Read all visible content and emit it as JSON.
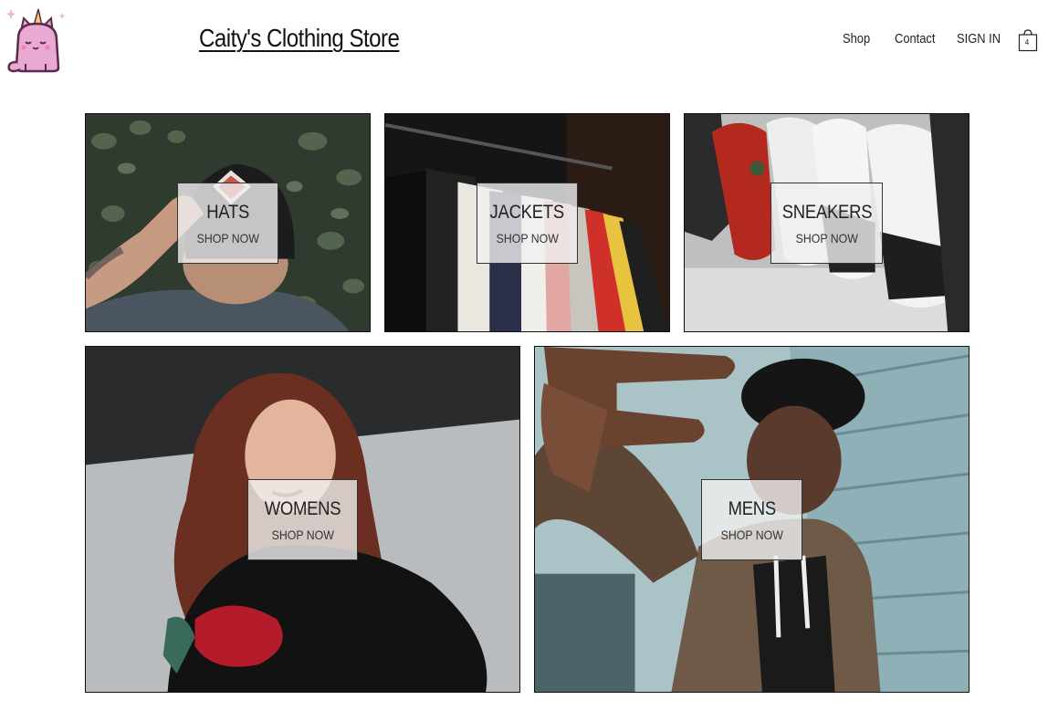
{
  "header": {
    "store_title": "Caity's Clothing Store",
    "logo_icon": "unicorn-cat-icon",
    "cart_icon": "shopping-bag-icon",
    "cart_count": "4"
  },
  "nav": {
    "shop": "Shop",
    "contact": "Contact",
    "sign_in": "SIGN IN"
  },
  "tiles": [
    {
      "name": "HATS",
      "cta": "SHOP NOW"
    },
    {
      "name": "JACKETS",
      "cta": "SHOP NOW"
    },
    {
      "name": "SNEAKERS",
      "cta": "SHOP NOW"
    },
    {
      "name": "WOMENS",
      "cta": "SHOP NOW"
    },
    {
      "name": "MENS",
      "cta": "SHOP NOW"
    }
  ],
  "colors": {
    "background": "#ffffff",
    "text": "#222222",
    "label_box": "#f0f0f0"
  }
}
